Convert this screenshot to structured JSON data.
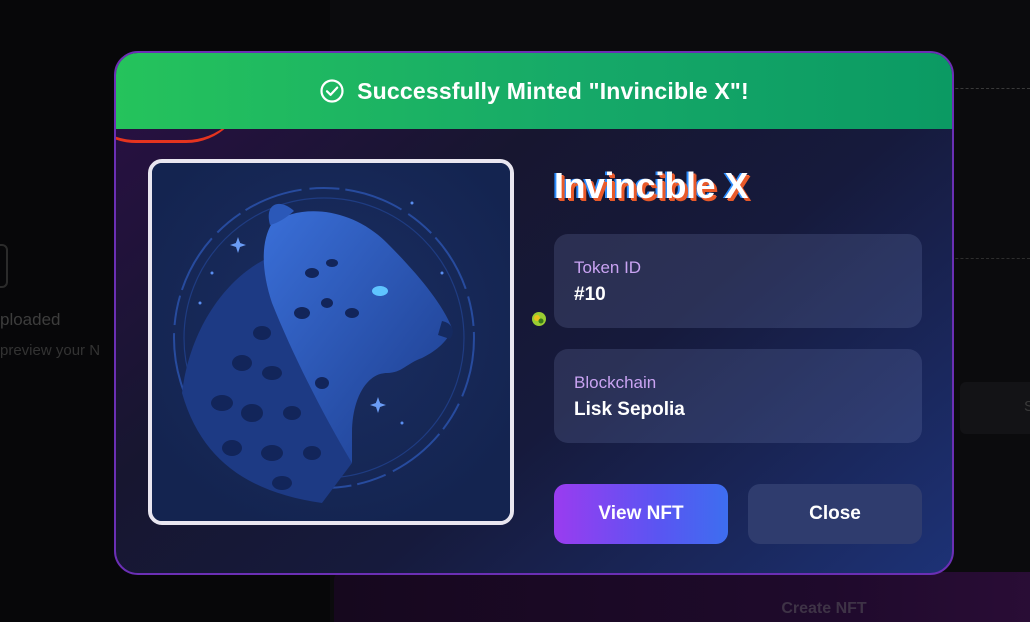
{
  "background": {
    "uploaded_text": "ploaded",
    "preview_text": "preview your N",
    "field_text": "S",
    "create_button_label": "Create NFT"
  },
  "modal": {
    "banner_text": "Successfully Minted \"Invincible X\"!",
    "banner_icon": "check-circle-icon",
    "nft_name": "Invincible X",
    "token_id": {
      "label": "Token ID",
      "value": "#10"
    },
    "blockchain": {
      "label": "Blockchain",
      "value": "Lisk Sepolia"
    },
    "view_button_label": "View NFT",
    "close_button_label": "Close",
    "colors": {
      "banner_start": "#25c35c",
      "banner_end": "#0b9a63",
      "label": "#c9a3f2",
      "view_button_start": "#9a3cf0",
      "view_button_end": "#3d6ef0",
      "close_button": "#2f3c6e"
    }
  }
}
